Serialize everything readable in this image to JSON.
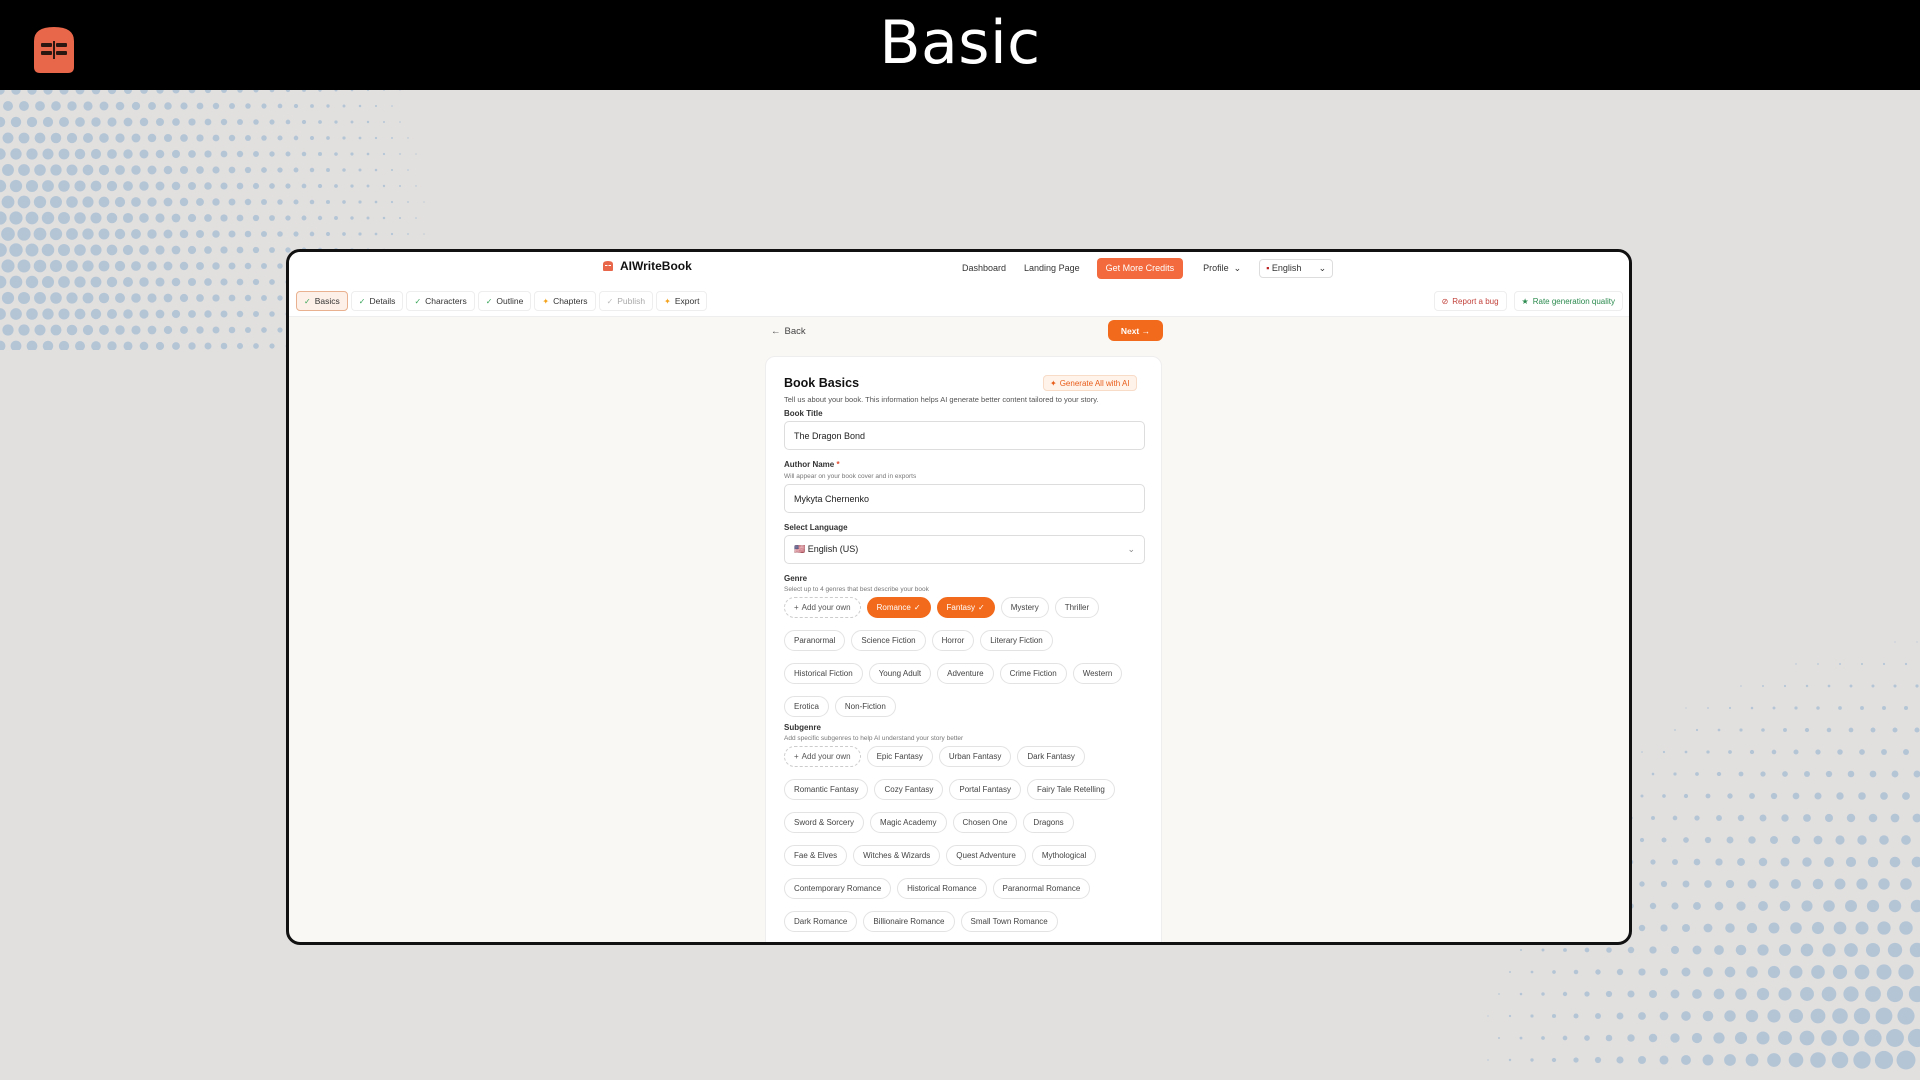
{
  "slide": {
    "title": "Basic"
  },
  "app": {
    "brand": "AIWriteBook",
    "nav": {
      "dashboard": "Dashboard",
      "landing": "Landing Page",
      "credits": "Get More Credits",
      "profile": "Profile",
      "language": "English"
    },
    "tabs": [
      {
        "label": "Basics",
        "state": "active"
      },
      {
        "label": "Details",
        "state": "done"
      },
      {
        "label": "Characters",
        "state": "done"
      },
      {
        "label": "Outline",
        "state": "done"
      },
      {
        "label": "Chapters",
        "state": "star"
      },
      {
        "label": "Publish",
        "state": "muted"
      },
      {
        "label": "Export",
        "state": "star"
      }
    ],
    "actions": {
      "report": "Report a bug",
      "rate": "Rate generation quality"
    },
    "back": "Back",
    "next": "Next →"
  },
  "form": {
    "title": "Book Basics",
    "generate_all": "Generate All with AI",
    "description": "Tell us about your book. This information helps AI generate better content tailored to your story.",
    "book_title_label": "Book Title",
    "book_title_value": "The Dragon Bond",
    "author_label": "Author Name",
    "author_required": "*",
    "author_hint": "Will appear on your book cover and in exports",
    "author_value": "Mykyta Chernenko",
    "language_label": "Select Language",
    "language_value": "🇺🇸 English (US)",
    "genre_label": "Genre",
    "genre_hint": "Select up to 4 genres that best describe your book",
    "add_own": "Add your own",
    "genres": [
      {
        "label": "Romance",
        "selected": true
      },
      {
        "label": "Fantasy",
        "selected": true
      },
      {
        "label": "Mystery",
        "selected": false
      },
      {
        "label": "Thriller",
        "selected": false
      },
      {
        "label": "Paranormal",
        "selected": false
      },
      {
        "label": "Science Fiction",
        "selected": false
      },
      {
        "label": "Horror",
        "selected": false
      },
      {
        "label": "Literary Fiction",
        "selected": false
      },
      {
        "label": "Historical Fiction",
        "selected": false
      },
      {
        "label": "Young Adult",
        "selected": false
      },
      {
        "label": "Adventure",
        "selected": false
      },
      {
        "label": "Crime Fiction",
        "selected": false
      },
      {
        "label": "Western",
        "selected": false
      },
      {
        "label": "Erotica",
        "selected": false
      },
      {
        "label": "Non-Fiction",
        "selected": false
      }
    ],
    "subgenre_label": "Subgenre",
    "subgenre_hint": "Add specific subgenres to help AI understand your story better",
    "subgenres": [
      "Epic Fantasy",
      "Urban Fantasy",
      "Dark Fantasy",
      "Romantic Fantasy",
      "Cozy Fantasy",
      "Portal Fantasy",
      "Fairy Tale Retelling",
      "Sword & Sorcery",
      "Magic Academy",
      "Chosen One",
      "Dragons",
      "Fae & Elves",
      "Witches & Wizards",
      "Quest Adventure",
      "Mythological",
      "Contemporary Romance",
      "Historical Romance",
      "Paranormal Romance",
      "Dark Romance",
      "Billionaire Romance",
      "Small Town Romance"
    ]
  },
  "colors": {
    "accent": "#f26a1b",
    "credits": "#f26a3d",
    "dots": "#8fb3cf"
  }
}
